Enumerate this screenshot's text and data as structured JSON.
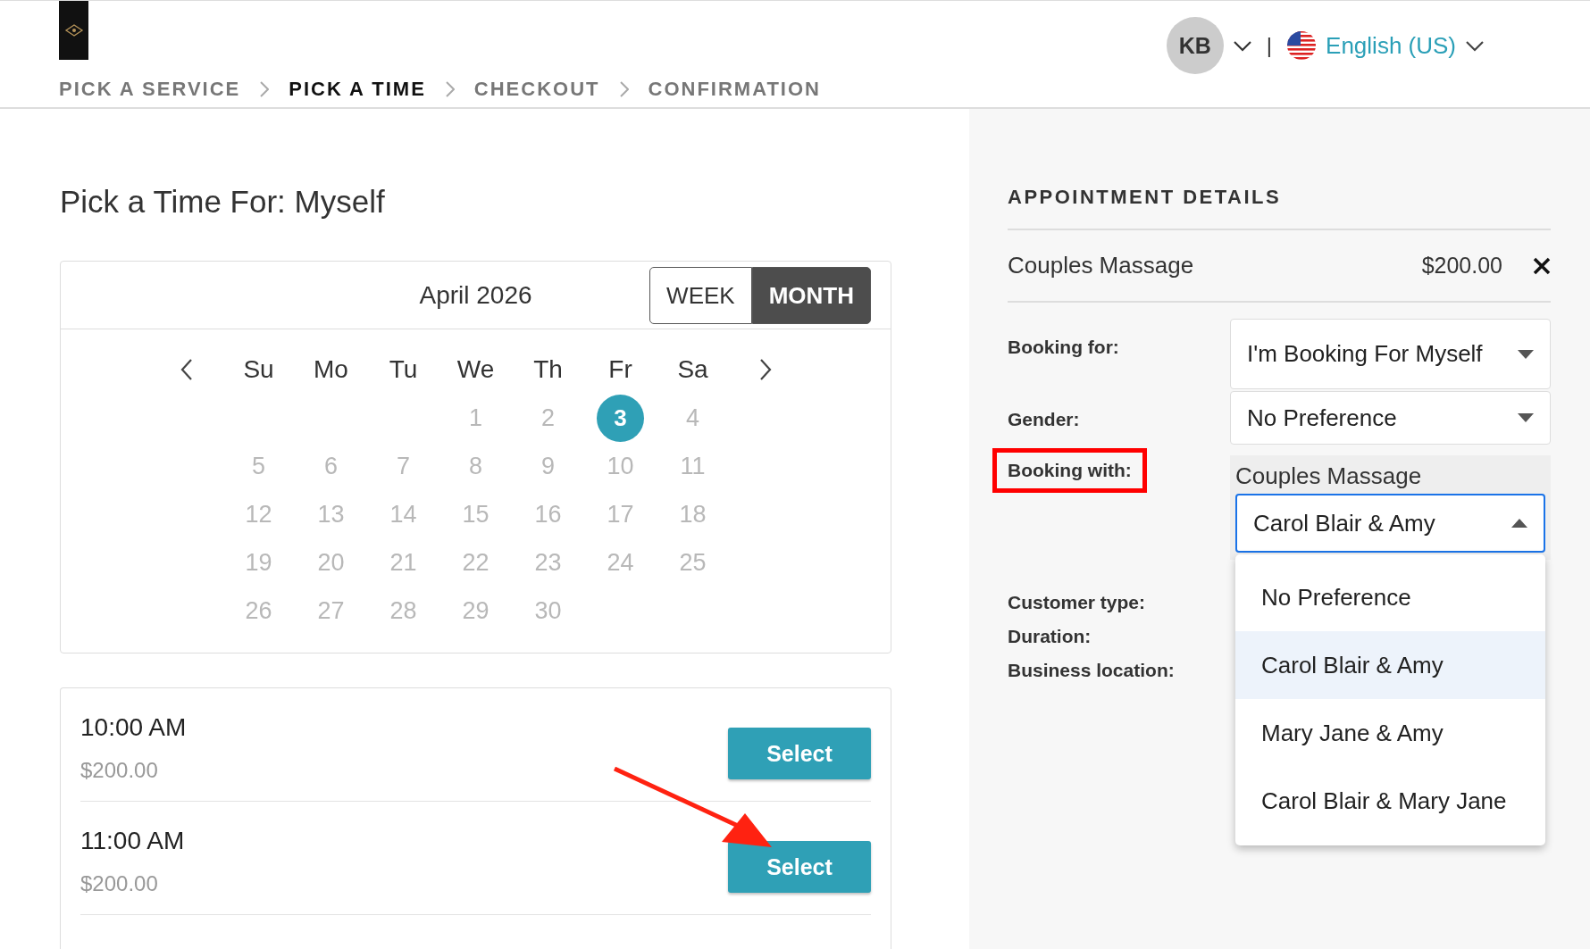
{
  "header": {
    "user_initials": "KB",
    "separator": "|",
    "language": "English (US)"
  },
  "steps": [
    {
      "label": "PICK A SERVICE",
      "selected": false
    },
    {
      "label": "PICK A TIME",
      "selected": true
    },
    {
      "label": "CHECKOUT",
      "selected": false
    },
    {
      "label": "CONFIRMATION",
      "selected": false
    }
  ],
  "title": "Pick a Time For: Myself",
  "calendar": {
    "month": "April 2026",
    "views": [
      {
        "label": "WEEK",
        "selected": false
      },
      {
        "label": "MONTH",
        "selected": true
      }
    ],
    "weekdays": [
      "Su",
      "Mo",
      "Tu",
      "We",
      "Th",
      "Fr",
      "Sa"
    ],
    "weeks": [
      {
        "starts_mid_week": true,
        "days": [
          {
            "day": "1",
            "selected": false
          },
          {
            "day": "2",
            "selected": false
          },
          {
            "day": "3",
            "selected": true
          },
          {
            "day": "4",
            "selected": false
          }
        ]
      },
      {
        "days": [
          {
            "day": "5",
            "selected": false
          },
          {
            "day": "6",
            "selected": false
          },
          {
            "day": "7",
            "selected": false
          },
          {
            "day": "8",
            "selected": false
          },
          {
            "day": "9",
            "selected": false
          },
          {
            "day": "10",
            "selected": false
          },
          {
            "day": "11",
            "selected": false
          }
        ]
      },
      {
        "days": [
          {
            "day": "12",
            "selected": false
          },
          {
            "day": "13",
            "selected": false
          },
          {
            "day": "14",
            "selected": false
          },
          {
            "day": "15",
            "selected": false
          },
          {
            "day": "16",
            "selected": false
          },
          {
            "day": "17",
            "selected": false
          },
          {
            "day": "18",
            "selected": false
          }
        ]
      },
      {
        "days": [
          {
            "day": "19",
            "selected": false
          },
          {
            "day": "20",
            "selected": false
          },
          {
            "day": "21",
            "selected": false
          },
          {
            "day": "22",
            "selected": false
          },
          {
            "day": "23",
            "selected": false
          },
          {
            "day": "24",
            "selected": false
          },
          {
            "day": "25",
            "selected": false
          }
        ]
      },
      {
        "days": [
          {
            "day": "26",
            "selected": false
          },
          {
            "day": "27",
            "selected": false
          },
          {
            "day": "28",
            "selected": false
          },
          {
            "day": "29",
            "selected": false
          },
          {
            "day": "30",
            "selected": false
          }
        ]
      }
    ]
  },
  "slots": [
    {
      "time": "10:00 AM",
      "price": "$200.00",
      "button": "Select"
    },
    {
      "time": "11:00 AM",
      "price": "$200.00",
      "button": "Select",
      "arrow": true
    }
  ],
  "details": {
    "heading": "APPOINTMENT DETAILS",
    "service": "Couples Massage",
    "price": "$200.00",
    "fields": [
      {
        "label": "Booking for:",
        "kind": "select",
        "value": "I'm Booking For Myself"
      },
      {
        "label": "Gender:",
        "kind": "select",
        "value": "No Preference"
      },
      {
        "label": "Booking with:",
        "kind": "group",
        "highlighted": true,
        "group_label": "Couples Massage",
        "value": "Carol Blair & Amy",
        "expanded": true,
        "options": [
          {
            "label": "No Preference",
            "selected": false
          },
          {
            "label": "Carol Blair & Amy",
            "selected": true
          },
          {
            "label": "Mary Jane & Amy",
            "selected": false
          },
          {
            "label": "Carol Blair & Mary Jane",
            "selected": false
          }
        ]
      },
      {
        "label": "Customer type:",
        "kind": "text"
      },
      {
        "label": "Duration:",
        "kind": "text"
      },
      {
        "label": "Business location:",
        "kind": "text"
      }
    ]
  }
}
